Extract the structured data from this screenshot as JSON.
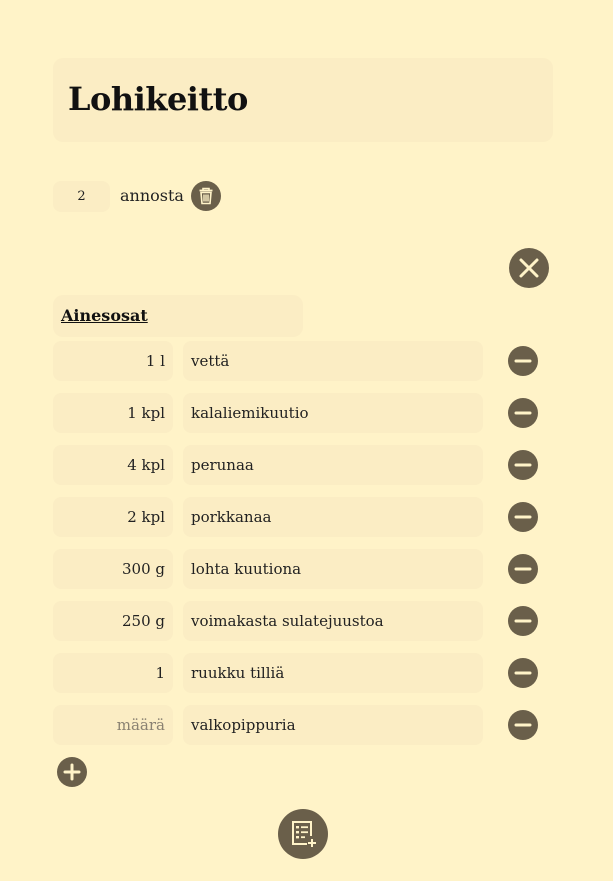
{
  "recipe": {
    "title": "Lohikeitto",
    "servings": "2",
    "servings_unit": "annosta"
  },
  "ingredients_section": {
    "title": "Ainesosat",
    "quantity_placeholder": "määrä",
    "items": [
      {
        "quantity": "1 l",
        "name": "vettä"
      },
      {
        "quantity": "1 kpl",
        "name": "kalaliemikuutio"
      },
      {
        "quantity": "4 kpl",
        "name": "perunaa"
      },
      {
        "quantity": "2 kpl",
        "name": "porkkanaa"
      },
      {
        "quantity": "300 g",
        "name": "lohta kuutiona"
      },
      {
        "quantity": "250 g",
        "name": "voimakasta sulatejuustoa"
      },
      {
        "quantity": "1",
        "name": "ruukku tilliä"
      },
      {
        "quantity": "",
        "name": "valkopippuria"
      }
    ]
  },
  "icons": {
    "delete_recipe": "trash-icon",
    "close_section": "close-icon",
    "remove_ingredient": "minus-icon",
    "add_ingredient": "plus-icon",
    "add_recipe_section": "list-add-icon"
  },
  "colors": {
    "background": "#fff3c8",
    "field": "#fbedc4",
    "button": "#6a5f4a"
  }
}
